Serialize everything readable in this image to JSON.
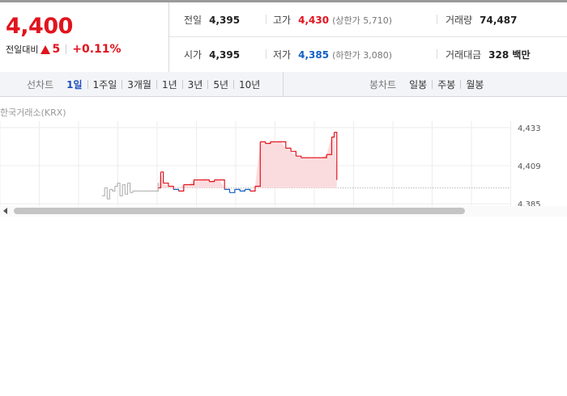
{
  "quote": {
    "price": "4,400",
    "change_label": "전일대비",
    "change_value": "5",
    "change_percent": "+0.11%",
    "direction": "up",
    "colors": {
      "up": "#e1141e",
      "down": "#1261c4"
    }
  },
  "stats": {
    "prev_close": {
      "label": "전일",
      "value": "4,395"
    },
    "high": {
      "label": "고가",
      "value": "4,430",
      "sub": "(상한가 5,710)"
    },
    "volume": {
      "label": "거래량",
      "value": "74,487"
    },
    "open": {
      "label": "시가",
      "value": "4,395"
    },
    "low": {
      "label": "저가",
      "value": "4,385",
      "sub": "(하한가 3,080)"
    },
    "trade_value": {
      "label": "거래대금",
      "value": "328 백만"
    }
  },
  "tabs": {
    "line_label": "선차트",
    "line": [
      "1일",
      "1주일",
      "3개월",
      "1년",
      "3년",
      "5년",
      "10년"
    ],
    "line_active": "1일",
    "candle_label": "봉차트",
    "candle": [
      "일봉",
      "주봉",
      "월봉"
    ]
  },
  "source": "한국거래소(KRX)",
  "scrollbar": {
    "left_arrow_icon": "triangle-left-icon"
  },
  "chart_data": {
    "type": "line",
    "title": "",
    "xlabel": "",
    "ylabel": "",
    "y_ticks": [
      "4,433",
      "4,409",
      "4,385"
    ],
    "ylim": [
      4383,
      4437
    ],
    "reference": 4395,
    "grid": true,
    "series": [
      {
        "segment": "pre-market",
        "color": "#b6b6b6",
        "x": [
          0.2,
          0.205,
          0.21,
          0.215,
          0.22,
          0.225,
          0.23,
          0.235,
          0.24,
          0.245,
          0.25,
          0.255,
          0.26,
          0.265,
          0.27,
          0.275,
          0.28,
          0.285,
          0.29,
          0.295,
          0.3,
          0.305,
          0.31
        ],
        "values": [
          4390,
          4395,
          4388,
          4394,
          4393,
          4396,
          4398,
          4390,
          4397,
          4391,
          4398,
          4392,
          4393,
          4393,
          4393,
          4393,
          4393,
          4393,
          4393,
          4393,
          4393,
          4393,
          4398
        ]
      },
      {
        "segment": "regular-session",
        "color": "#e1141e",
        "fill": "#fbdcde",
        "down_color": "#1261c4",
        "x": [
          0.31,
          0.315,
          0.32,
          0.33,
          0.34,
          0.35,
          0.36,
          0.37,
          0.38,
          0.39,
          0.4,
          0.41,
          0.42,
          0.43,
          0.44,
          0.45,
          0.46,
          0.47,
          0.48,
          0.49,
          0.5,
          0.51,
          0.52,
          0.53,
          0.54,
          0.55,
          0.56,
          0.57,
          0.58,
          0.59,
          0.6,
          0.61,
          0.62,
          0.63,
          0.64,
          0.65,
          0.655,
          0.66
        ],
        "values": [
          4395,
          4405,
          4398,
          4396,
          4394,
          4393,
          4397,
          4397,
          4400,
          4400,
          4400,
          4399,
          4400,
          4400,
          4394,
          4392,
          4394,
          4393,
          4394,
          4393,
          4396,
          4424,
          4423,
          4424,
          4424,
          4424,
          4420,
          4418,
          4415,
          4414,
          4414,
          4414,
          4414,
          4414,
          4416,
          4427,
          4430,
          4400
        ]
      }
    ]
  }
}
